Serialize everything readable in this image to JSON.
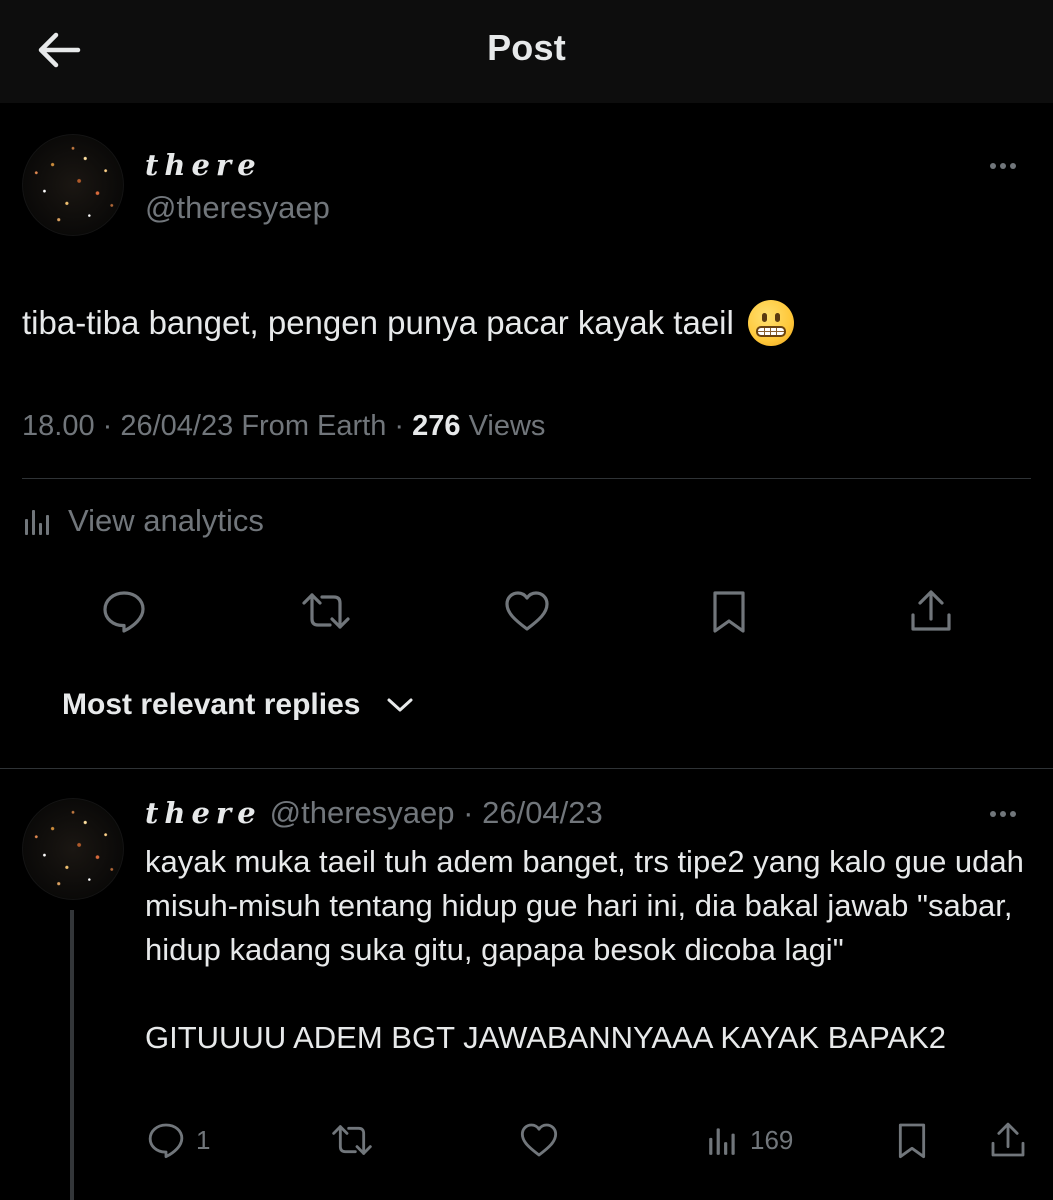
{
  "header": {
    "title": "Post"
  },
  "post": {
    "display_name": "there",
    "handle": "@theresyaep",
    "text": "tiba-tiba banget, pengen punya pacar kayak taeil",
    "emoji_icon": "grimacing-face-icon",
    "meta": {
      "time": "18.00",
      "date": "26/04/23",
      "source": "From Earth",
      "views_count": "276",
      "views_label": "Views"
    },
    "analytics_label": "View analytics"
  },
  "sort": {
    "label": "Most relevant replies"
  },
  "reply": {
    "display_name": "there",
    "handle": "@theresyaep",
    "date": "26/04/23",
    "text": "kayak muka taeil tuh adem banget, trs tipe2 yang kalo gue udah misuh-misuh tentang hidup gue hari ini, dia bakal jawab \"sabar, hidup kadang suka gitu, gapapa besok dicoba lagi\"\n\nGITUUUU ADEM BGT JAWABANNYAAA KAYAK BAPAK2",
    "reply_count": "1",
    "views_count": "169"
  },
  "colors": {
    "background": "#000000",
    "header_bg": "#0d0d0d",
    "text_primary": "#e7e9ea",
    "text_secondary": "#71767b",
    "divider": "#2f3336"
  }
}
